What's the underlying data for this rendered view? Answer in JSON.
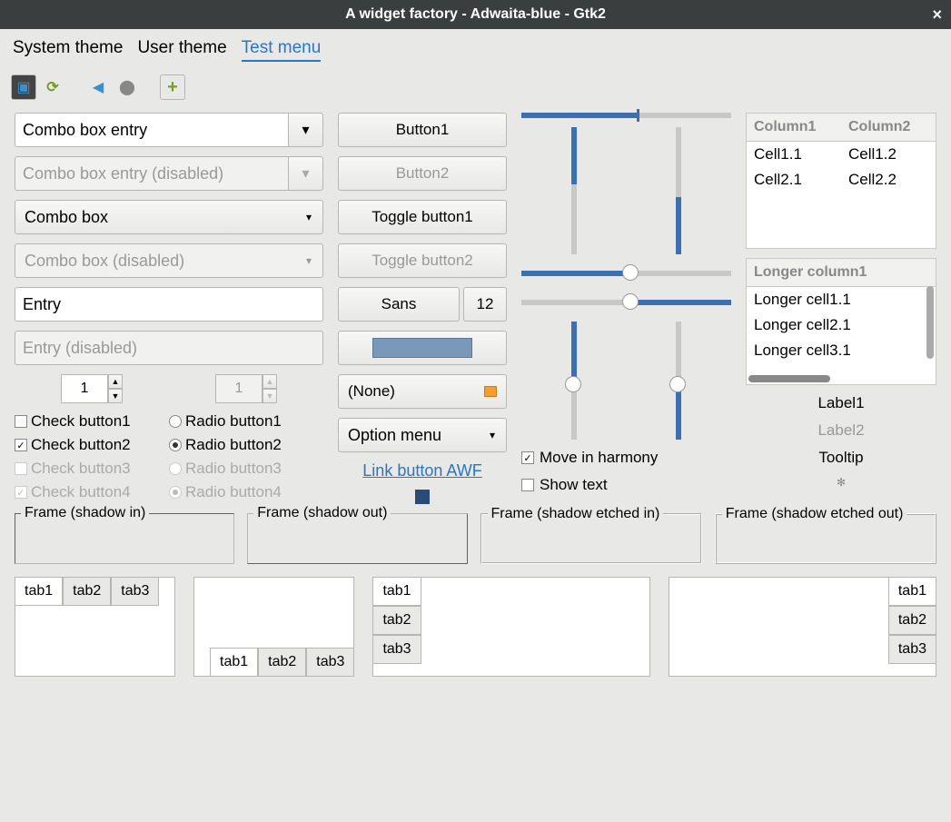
{
  "window": {
    "title": "A widget factory - Adwaita-blue - Gtk2"
  },
  "menubar": {
    "items": [
      "System theme",
      "User theme",
      "Test menu"
    ],
    "active_index": 2
  },
  "col1": {
    "combo_entry": "Combo box entry",
    "combo_entry_disabled": "Combo box entry (disabled)",
    "combo_box": "Combo box",
    "combo_box_disabled": "Combo box (disabled)",
    "entry": "Entry",
    "entry_disabled": "Entry (disabled)",
    "spin1": "1",
    "spin2": "1",
    "checks": [
      "Check button1",
      "Check button2",
      "Check button3",
      "Check button4"
    ],
    "radios": [
      "Radio button1",
      "Radio button2",
      "Radio button3",
      "Radio button4"
    ]
  },
  "col2": {
    "button1": "Button1",
    "button2": "Button2",
    "toggle1": "Toggle button1",
    "toggle2": "Toggle button2",
    "font_name": "Sans",
    "font_size": "12",
    "color": "#7a99b9",
    "file": "(None)",
    "option": "Option menu",
    "link": "Link button AWF"
  },
  "col3": {
    "harmony": "Move in harmony",
    "showtext": "Show text"
  },
  "col4": {
    "table1": {
      "headers": [
        "Column1",
        "Column2"
      ],
      "rows": [
        [
          "Cell1.1",
          "Cell1.2"
        ],
        [
          "Cell2.1",
          "Cell2.2"
        ]
      ]
    },
    "table2": {
      "header": "Longer column1",
      "rows": [
        "Longer cell1.1",
        "Longer cell2.1",
        "Longer cell3.1"
      ]
    },
    "label1": "Label1",
    "label2": "Label2",
    "tooltip": "Tooltip"
  },
  "frames": [
    "Frame (shadow in)",
    "Frame (shadow out)",
    "Frame (shadow etched in)",
    "Frame (shadow etched out)"
  ],
  "tabs": [
    "tab1",
    "tab2",
    "tab3"
  ]
}
